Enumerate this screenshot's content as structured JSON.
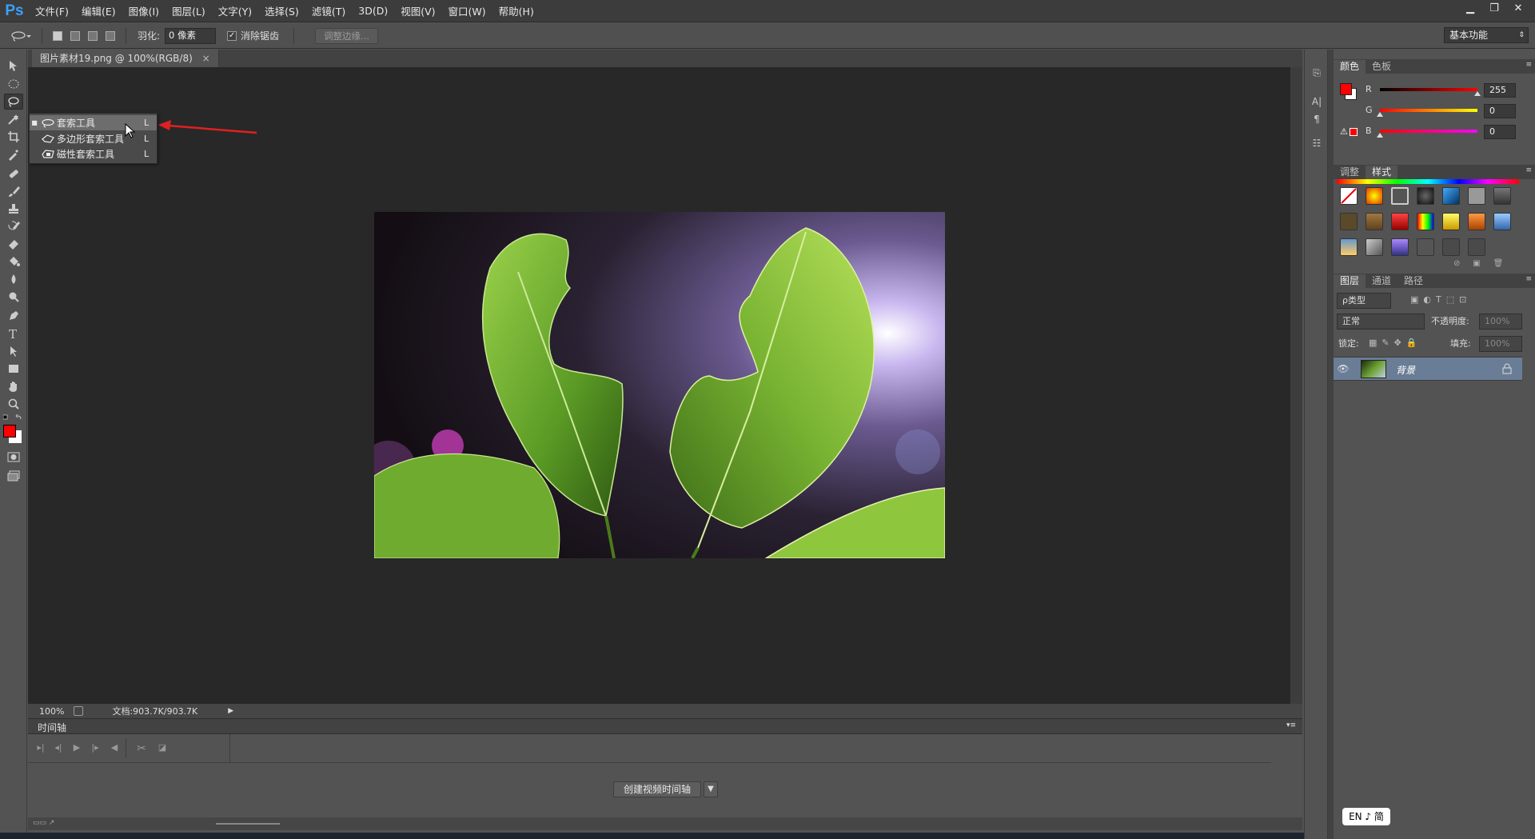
{
  "app": {
    "logo": "Ps"
  },
  "menu": [
    "文件(F)",
    "编辑(E)",
    "图像(I)",
    "图层(L)",
    "文字(Y)",
    "选择(S)",
    "滤镜(T)",
    "3D(D)",
    "视图(V)",
    "窗口(W)",
    "帮助(H)"
  ],
  "options": {
    "feather_label": "羽化:",
    "feather_value": "0 像素",
    "antialias_label": "消除锯齿",
    "antialias_checked": "✓",
    "refine_edge": "调整边缘...",
    "workspace": "基本功能"
  },
  "document": {
    "tab_title": "图片素材19.png @ 100%(RGB/8)",
    "close": "×"
  },
  "status": {
    "zoom": "100%",
    "doc_info": "文档:903.7K/903.7K"
  },
  "timeline": {
    "title": "时间轴",
    "create_button": "创建视频时间轴"
  },
  "lasso_flyout": {
    "items": [
      {
        "label": "套索工具",
        "key": "L"
      },
      {
        "label": "多边形套索工具",
        "key": "L"
      },
      {
        "label": "磁性套索工具",
        "key": "L"
      }
    ]
  },
  "color_panel": {
    "tabs": [
      "颜色",
      "色板"
    ],
    "channels": [
      {
        "label": "R",
        "value": "255"
      },
      {
        "label": "G",
        "value": "0"
      },
      {
        "label": "B",
        "value": "0"
      }
    ],
    "foreground": "#ff0000",
    "background": "#ffffff"
  },
  "styles_panel": {
    "tabs": [
      "调整",
      "样式"
    ]
  },
  "layers_panel": {
    "tabs": [
      "图层",
      "通道",
      "路径"
    ],
    "filter_kind": "ρ类型",
    "blend_mode": "正常",
    "opacity_label": "不透明度:",
    "opacity_value": "100%",
    "lock_label": "锁定:",
    "fill_label": "填充:",
    "fill_value": "100%",
    "layer_name": "背景"
  },
  "ime": {
    "text": "EN ♪ 简"
  }
}
